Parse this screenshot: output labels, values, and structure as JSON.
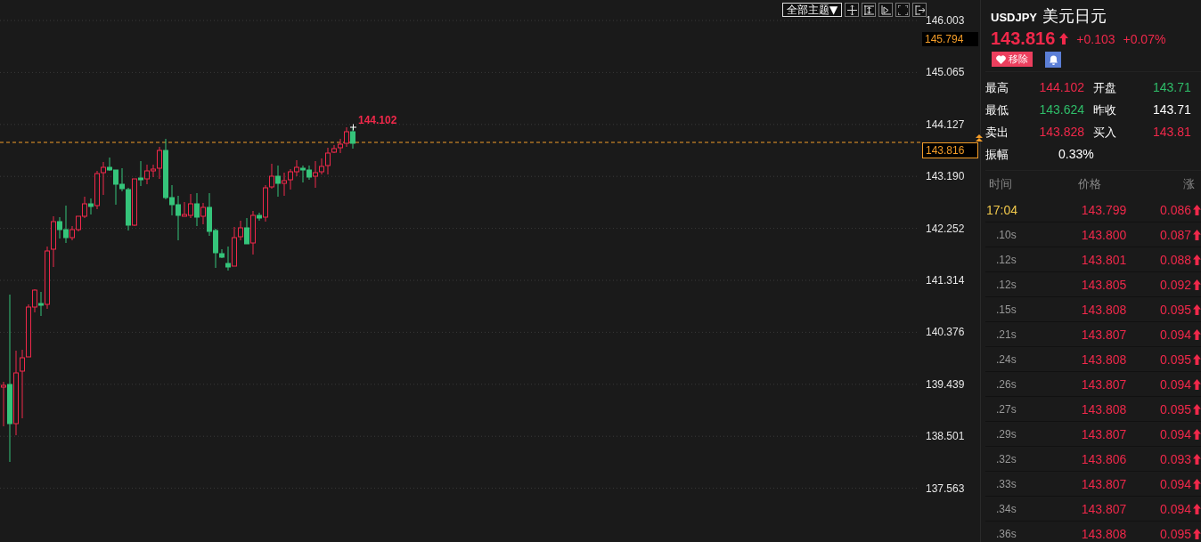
{
  "toolbar": {
    "theme_button": "全部主题▼"
  },
  "chart": {
    "price_labels": [
      "146.003",
      "145.065",
      "144.127",
      "143.190",
      "142.252",
      "141.314",
      "140.376",
      "139.439",
      "138.501",
      "137.563"
    ],
    "crosshair_label": "145.794",
    "current_price_label": "143.816",
    "high_marker": "144.102"
  },
  "quote": {
    "symbol": "USDJPY",
    "name": "美元日元",
    "price": "143.816",
    "up": true,
    "change": "+0.103",
    "change_pct": "+0.07%",
    "remove_button": "移除"
  },
  "stats": [
    {
      "label": "最高",
      "value": "144.102",
      "color": "#f0284a"
    },
    {
      "label": "开盘",
      "value": "143.71",
      "color": "#2fbf6a"
    },
    {
      "label": "最低",
      "value": "143.624",
      "color": "#2fbf6a"
    },
    {
      "label": "昨收",
      "value": "143.71",
      "color": "#ffffff"
    },
    {
      "label": "卖出",
      "value": "143.828",
      "color": "#f0284a"
    },
    {
      "label": "买入",
      "value": "143.81",
      "color": "#f0284a"
    },
    {
      "label": "振幅",
      "value": "0.33%",
      "color": "#ffffff"
    }
  ],
  "ticks": {
    "columns": [
      "时间",
      "价格",
      "涨"
    ],
    "rows": [
      {
        "kind": "minute",
        "time": "17:04",
        "price": "143.799",
        "change": "0.086",
        "up": true
      },
      {
        "kind": "second",
        "time": ".10s",
        "price": "143.800",
        "change": "0.087",
        "up": true
      },
      {
        "kind": "second",
        "time": ".12s",
        "price": "143.801",
        "change": "0.088",
        "up": true
      },
      {
        "kind": "second",
        "time": ".12s",
        "price": "143.805",
        "change": "0.092",
        "up": true
      },
      {
        "kind": "second",
        "time": ".15s",
        "price": "143.808",
        "change": "0.095",
        "up": true
      },
      {
        "kind": "second",
        "time": ".21s",
        "price": "143.807",
        "change": "0.094",
        "up": true
      },
      {
        "kind": "second",
        "time": ".24s",
        "price": "143.808",
        "change": "0.095",
        "up": true
      },
      {
        "kind": "second",
        "time": ".26s",
        "price": "143.807",
        "change": "0.094",
        "up": true
      },
      {
        "kind": "second",
        "time": ".27s",
        "price": "143.808",
        "change": "0.095",
        "up": true
      },
      {
        "kind": "second",
        "time": ".29s",
        "price": "143.807",
        "change": "0.094",
        "up": true
      },
      {
        "kind": "second",
        "time": ".32s",
        "price": "143.806",
        "change": "0.093",
        "up": true
      },
      {
        "kind": "second",
        "time": ".33s",
        "price": "143.807",
        "change": "0.094",
        "up": true
      },
      {
        "kind": "second",
        "time": ".34s",
        "price": "143.807",
        "change": "0.094",
        "up": true
      },
      {
        "kind": "second",
        "time": ".36s",
        "price": "143.808",
        "change": "0.095",
        "up": true
      }
    ]
  }
}
